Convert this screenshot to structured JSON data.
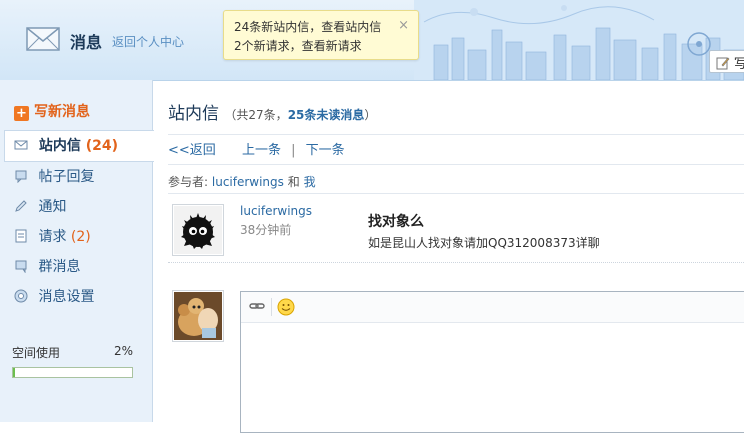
{
  "header": {
    "title": "消息",
    "back_link": "返回个人中心",
    "notice_line1_prefix": "24条新站内信，",
    "notice_line1_link": "查看站内信",
    "notice_line2_prefix": "2个新请求，",
    "notice_line2_link": "查看新请求",
    "close": "×",
    "write_label": "写"
  },
  "sidebar": {
    "compose": "写新消息",
    "items": [
      {
        "label": "站内信",
        "count": "(24)",
        "icon": "mail-icon"
      },
      {
        "label": "帖子回复",
        "count": "",
        "icon": "comment-icon"
      },
      {
        "label": "通知",
        "count": "",
        "icon": "pencil-icon"
      },
      {
        "label": "请求",
        "count": "(2)",
        "icon": "document-icon"
      },
      {
        "label": "群消息",
        "count": "",
        "icon": "chat-icon"
      },
      {
        "label": "消息设置",
        "count": "",
        "icon": "settings-icon"
      }
    ],
    "space_label": "空间使用",
    "space_pct": "2%",
    "space_fraction": 0.02
  },
  "main": {
    "title": "站内信",
    "sub_prefix": "（共27条，",
    "sub_unread": "25条未读消息",
    "sub_suffix": "）",
    "back": "<<返回",
    "prev": "上一条",
    "sep": "|",
    "next": "下一条",
    "participants_label": "参与者:",
    "participant1": "luciferwings",
    "and": "和",
    "participant2": "我",
    "message": {
      "sender": "luciferwings",
      "time": "38分钟前",
      "subject": "找对象么",
      "body": "如是昆山人找对象请加QQ312008373详聊"
    }
  },
  "colors": {
    "accent": "#2b6aa3",
    "orange": "#e2631b",
    "sidebar_bg": "#e8f1fa"
  }
}
